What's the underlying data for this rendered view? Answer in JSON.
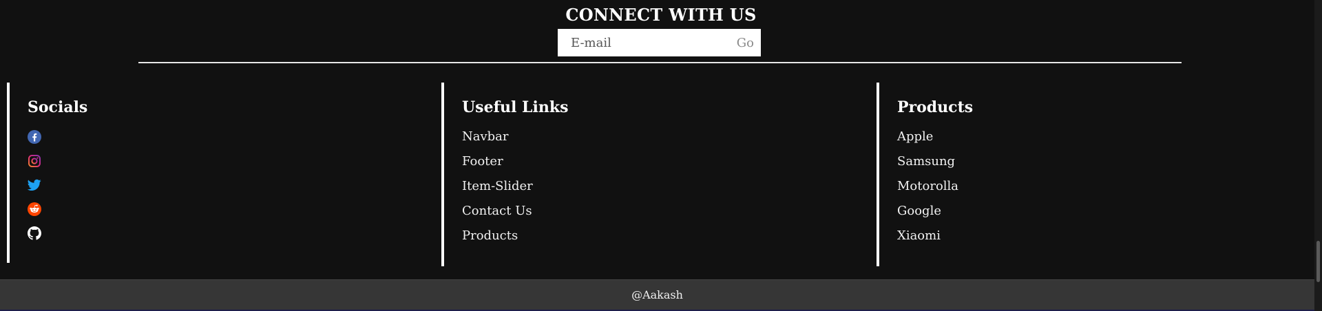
{
  "connect": {
    "title": "CONNECT WITH US",
    "email_placeholder": "E-mail",
    "go_label": "Go"
  },
  "socials": {
    "heading": "Socials",
    "icons": [
      {
        "name": "facebook-icon",
        "color": "#4267B2"
      },
      {
        "name": "instagram-icon",
        "color": "#E1306C"
      },
      {
        "name": "twitter-icon",
        "color": "#1DA1F2"
      },
      {
        "name": "reddit-icon",
        "color": "#FF4500"
      },
      {
        "name": "github-icon",
        "color": "#FFFFFF"
      }
    ]
  },
  "useful_links": {
    "heading": "Useful Links",
    "items": [
      "Navbar",
      "Footer",
      "Item-Slider",
      "Contact Us",
      "Products"
    ]
  },
  "products": {
    "heading": "Products",
    "items": [
      "Apple",
      "Samsung",
      "Motorolla",
      "Google",
      "Xiaomi"
    ]
  },
  "footer": {
    "credit": "@Aakash"
  },
  "colors": {
    "background": "#111111",
    "bottom_bar": "#363636",
    "text": "#FFFFFF"
  }
}
